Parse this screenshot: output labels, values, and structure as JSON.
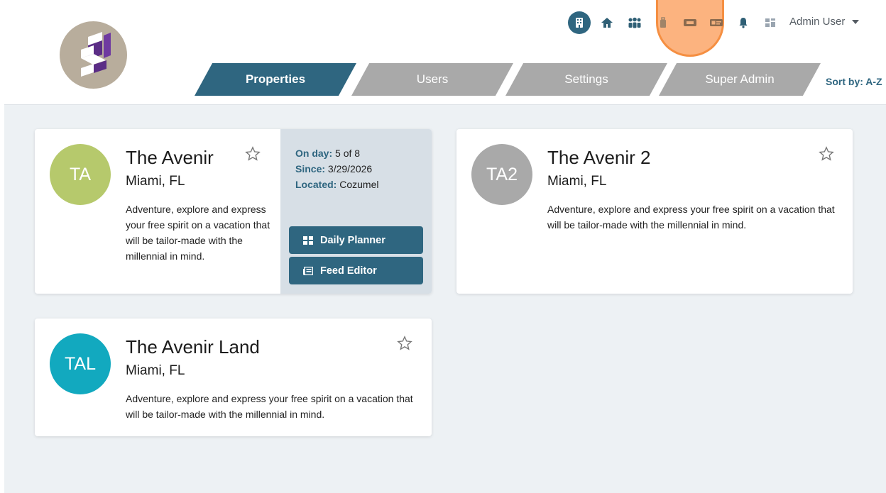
{
  "header": {
    "user_name": "Admin User",
    "icons": [
      "building-icon",
      "home-icon",
      "users-icon",
      "luggage-icon",
      "ticket-icon",
      "id-card-icon",
      "bell-icon",
      "dashboard-icon"
    ]
  },
  "tabs": [
    {
      "label": "Properties",
      "active": true
    },
    {
      "label": "Users",
      "active": false
    },
    {
      "label": "Settings",
      "active": false
    },
    {
      "label": "Super Admin",
      "active": false
    }
  ],
  "sort_label": "Sort by: A-Z",
  "properties": [
    {
      "initials": "TA",
      "name": "The Avenir",
      "location": "Miami, FL",
      "description": "Adventure, explore and express your free spirit on a vacation that will be tailor-made with the millennial in mind.",
      "on_day_label": "On day:",
      "on_day_value": "5 of 8",
      "since_label": "Since:",
      "since_value": "3/29/2026",
      "located_label": "Located:",
      "located_value": "Cozumel",
      "daily_planner_label": "Daily Planner",
      "feed_editor_label": "Feed Editor",
      "avatar_color": "#b6c96c"
    },
    {
      "initials": "TA2",
      "name": "The Avenir 2",
      "location": "Miami, FL",
      "description": "Adventure, explore and express your free spirit on a vacation that will be tailor-made with the millennial in mind.",
      "avatar_color": "#a9a9a9"
    },
    {
      "initials": "TAL",
      "name": "The Avenir Land",
      "location": "Miami, FL",
      "description": "Adventure, explore and express your free spirit on a vacation that will be tailor-made with the millennial in mind.",
      "avatar_color": "#12a9bf"
    }
  ],
  "colors": {
    "accent": "#2f6680",
    "tab_inactive": "#a9a9a9",
    "page_bg": "#edf1f4",
    "side_panel": "#d7dfe6",
    "highlight": "#fca668"
  }
}
